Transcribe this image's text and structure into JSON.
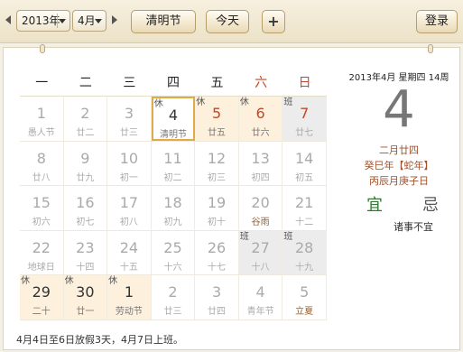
{
  "toolbar": {
    "year": "2013年",
    "month": "4月",
    "holiday_btn": "清明节",
    "today_btn": "今天",
    "add_btn": "+",
    "login_btn": "登录"
  },
  "weekdays": [
    "一",
    "二",
    "三",
    "四",
    "五",
    "六",
    "日"
  ],
  "weeks": [
    [
      {
        "d": "1",
        "s": "愚人节",
        "t": "p"
      },
      {
        "d": "2",
        "s": "廿二",
        "t": "p"
      },
      {
        "d": "3",
        "s": "廿三",
        "t": "p"
      },
      {
        "d": "4",
        "s": "清明节",
        "t": "today",
        "b": "休"
      },
      {
        "d": "5",
        "s": "廿五",
        "t": "rest",
        "b": "休"
      },
      {
        "d": "6",
        "s": "廿六",
        "t": "rest",
        "b": "休"
      },
      {
        "d": "7",
        "s": "廿七",
        "t": "work",
        "b": "班"
      }
    ],
    [
      {
        "d": "8",
        "s": "廿八",
        "t": "p"
      },
      {
        "d": "9",
        "s": "廿九",
        "t": "p"
      },
      {
        "d": "10",
        "s": "初一",
        "t": "p"
      },
      {
        "d": "11",
        "s": "初二",
        "t": "p"
      },
      {
        "d": "12",
        "s": "初三",
        "t": "p"
      },
      {
        "d": "13",
        "s": "初四",
        "t": "p"
      },
      {
        "d": "14",
        "s": "初五",
        "t": "p"
      }
    ],
    [
      {
        "d": "15",
        "s": "初六",
        "t": "p"
      },
      {
        "d": "16",
        "s": "初七",
        "t": "p"
      },
      {
        "d": "17",
        "s": "初八",
        "t": "p"
      },
      {
        "d": "18",
        "s": "初九",
        "t": "p"
      },
      {
        "d": "19",
        "s": "初十",
        "t": "p"
      },
      {
        "d": "20",
        "s": "谷雨",
        "t": "hl"
      },
      {
        "d": "21",
        "s": "十二",
        "t": "p"
      }
    ],
    [
      {
        "d": "22",
        "s": "地球日",
        "t": "p"
      },
      {
        "d": "23",
        "s": "十四",
        "t": "p"
      },
      {
        "d": "24",
        "s": "十五",
        "t": "p"
      },
      {
        "d": "25",
        "s": "十六",
        "t": "p"
      },
      {
        "d": "26",
        "s": "十七",
        "t": "p"
      },
      {
        "d": "27",
        "s": "十八",
        "t": "work",
        "b": "班"
      },
      {
        "d": "28",
        "s": "十九",
        "t": "work",
        "b": "班"
      }
    ],
    [
      {
        "d": "29",
        "s": "二十",
        "t": "rest",
        "b": "休"
      },
      {
        "d": "30",
        "s": "廿一",
        "t": "rest",
        "b": "休"
      },
      {
        "d": "1",
        "s": "劳动节",
        "t": "rest",
        "b": "休"
      },
      {
        "d": "2",
        "s": "廿三",
        "t": "p"
      },
      {
        "d": "3",
        "s": "廿四",
        "t": "p"
      },
      {
        "d": "4",
        "s": "青年节",
        "t": "p"
      },
      {
        "d": "5",
        "s": "立夏",
        "t": "hl"
      }
    ]
  ],
  "info": {
    "header": "2013年4月 星期四 14周",
    "big_day": "4",
    "lunar": "二月廿四",
    "ganzhi_year": "癸巳年【蛇年】",
    "ganzhi_md": "丙辰月庚子日",
    "yi": "宜",
    "ji": "忌",
    "note": "诸事不宜"
  },
  "footer": "4月4日至6日放假3天，4月7日上班。"
}
